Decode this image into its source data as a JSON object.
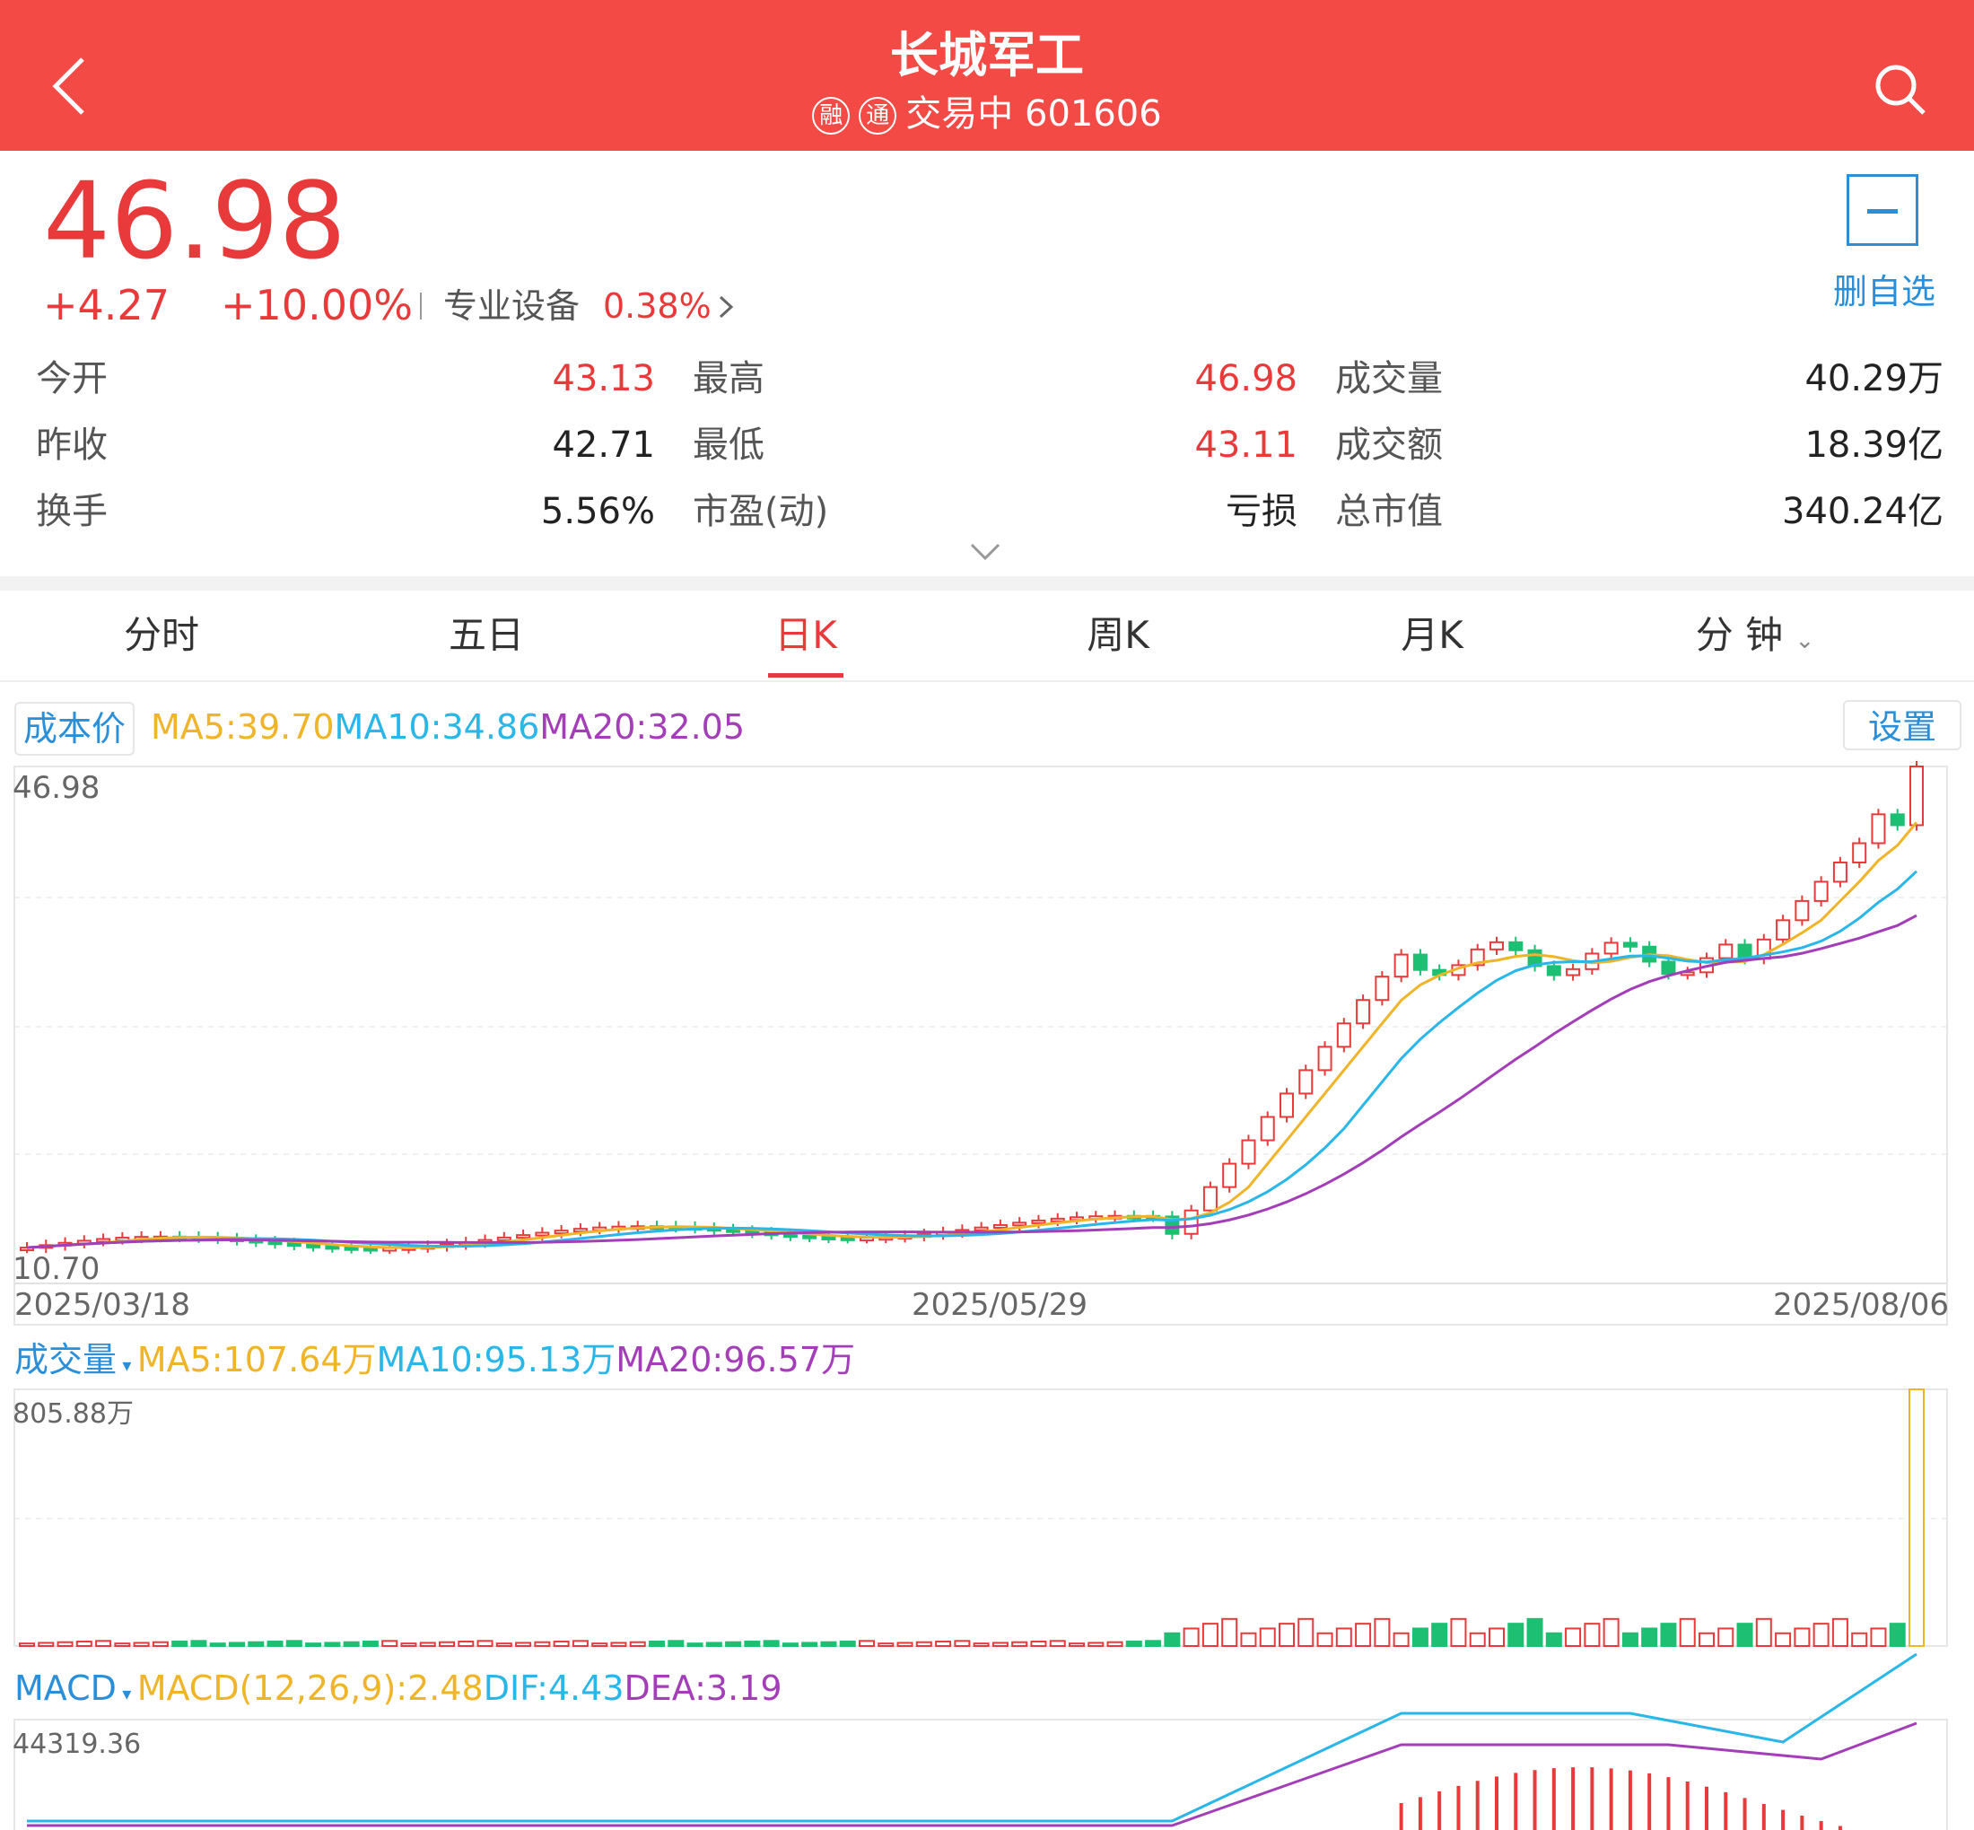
{
  "header": {
    "title": "长城军工",
    "badge1": "融",
    "badge2": "通",
    "status": "交易中",
    "code": "601606"
  },
  "quote": {
    "price": "46.98",
    "change": "+4.27",
    "change_pct": "+10.00%",
    "sector": "专业设备",
    "sector_pct": "0.38%",
    "remove_watchlist": "删自选",
    "stats": [
      {
        "label": "今开",
        "value": "43.13",
        "color": "red"
      },
      {
        "label": "最高",
        "value": "46.98",
        "color": "red"
      },
      {
        "label": "成交量",
        "value": "40.29万",
        "color": "dark"
      },
      {
        "label": "昨收",
        "value": "42.71",
        "color": "dark"
      },
      {
        "label": "最低",
        "value": "43.11",
        "color": "red"
      },
      {
        "label": "成交额",
        "value": "18.39亿",
        "color": "dark"
      },
      {
        "label": "换手",
        "value": "5.56%",
        "color": "dark"
      },
      {
        "label": "市盈(动)",
        "value": "亏损",
        "color": "dark"
      },
      {
        "label": "总市值",
        "value": "340.24亿",
        "color": "dark"
      }
    ]
  },
  "tabs": {
    "items": [
      "分时",
      "五日",
      "日K",
      "周K",
      "月K",
      "分 钟"
    ],
    "active": "日K"
  },
  "kline": {
    "cost_label": "成本价",
    "ma5": "MA5:39.70",
    "ma10": "MA10:34.86",
    "ma20": "MA20:32.05",
    "settings": "设置",
    "y_max": "46.98",
    "y_min": "10.70",
    "dates": [
      "2025/03/18",
      "2025/05/29",
      "2025/08/06"
    ]
  },
  "volume": {
    "label": "成交量",
    "ma5": "MA5:107.64万",
    "ma10": "MA10:95.13万",
    "ma20": "MA20:96.57万",
    "y_max": "805.88万"
  },
  "macd": {
    "label": "MACD",
    "macd": "MACD(12,26,9):2.48",
    "dif": "DIF:4.43",
    "dea": "DEA:3.19",
    "y_max": "44319.36"
  },
  "colors": {
    "header": "#f34a46",
    "up": "#e83a3a",
    "down": "#1dbf73",
    "ma5": "#f0b429",
    "ma10": "#29b6e8",
    "ma20": "#a43db8",
    "accent": "#2a8fd8"
  },
  "chart_data": {
    "type": "candlestick",
    "date_ticks": [
      "2025/03/18",
      "2025/05/29",
      "2025/08/06"
    ],
    "ylim": [
      10.7,
      46.98
    ],
    "closes_recent": [
      43.5,
      42.71,
      46.98
    ],
    "volume_ylim": [
      0,
      805.88
    ]
  }
}
